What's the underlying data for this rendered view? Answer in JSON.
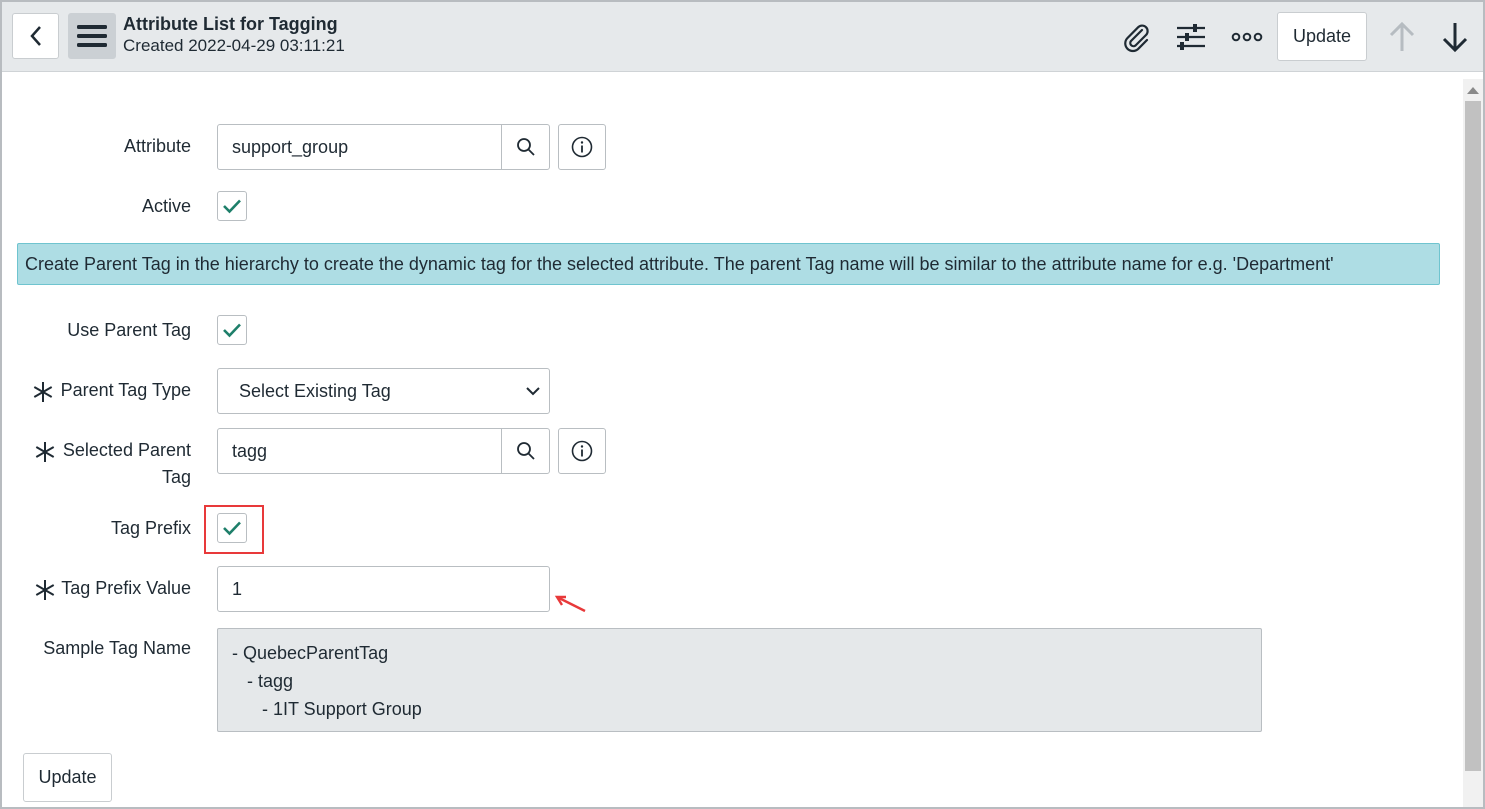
{
  "header": {
    "title": "Attribute List for Tagging",
    "subtitle": "Created 2022-04-29 03:11:21",
    "update_label": "Update"
  },
  "form": {
    "attribute": {
      "label": "Attribute",
      "value": "support_group"
    },
    "active": {
      "label": "Active",
      "checked": true
    },
    "info_message": "Create Parent Tag in the hierarchy to create the dynamic tag for the selected attribute. The parent Tag name will be similar to the attribute name for e.g. 'Department'",
    "use_parent_tag": {
      "label": "Use Parent Tag",
      "checked": true
    },
    "parent_tag_type": {
      "label": "Parent Tag Type",
      "value": "Select Existing Tag"
    },
    "selected_parent_tag": {
      "label_line1": "Selected Parent",
      "label_line2": "Tag",
      "value": "tagg"
    },
    "tag_prefix": {
      "label": "Tag Prefix",
      "checked": true
    },
    "tag_prefix_value": {
      "label": "Tag Prefix Value",
      "value": "1"
    },
    "sample_tag_name": {
      "label": "Sample Tag Name",
      "lines": [
        "- QuebecParentTag",
        "   - tagg",
        "      - 1IT Support Group"
      ]
    },
    "update_label": "Update"
  },
  "colors": {
    "check": "#1e7f6a",
    "annotation": "#e8393a",
    "banner": "#aedde4"
  }
}
